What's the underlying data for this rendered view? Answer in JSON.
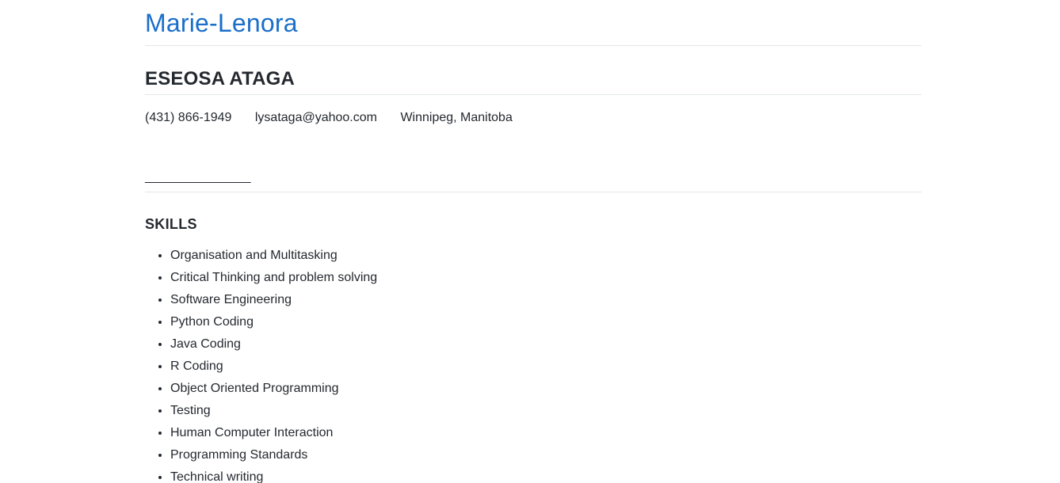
{
  "site": {
    "title": "Marie-Lenora"
  },
  "resume": {
    "name": "ESEOSA ATAGA",
    "contact": {
      "phone": "(431) 866-1949",
      "email": "lysataga@yahoo.com",
      "location": "Winnipeg, Manitoba"
    },
    "blank_line": "_______________",
    "skills_heading": "SKILLS",
    "skills": [
      "Organisation and Multitasking",
      "Critical Thinking and problem solving",
      "Software Engineering",
      "Python Coding",
      "Java Coding",
      "R Coding",
      "Object Oriented Programming",
      "Testing",
      "Human Computer Interaction",
      "Programming Standards",
      "Technical writing"
    ]
  },
  "colors": {
    "link_blue": "#1a6fc9",
    "text": "#24292f",
    "rule": "#e3e6ea"
  }
}
